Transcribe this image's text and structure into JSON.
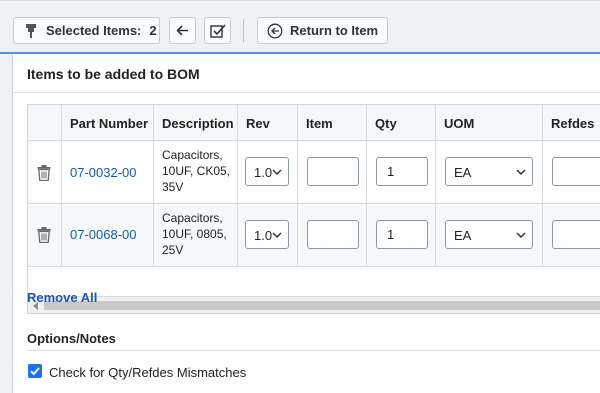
{
  "toolbar": {
    "selected_label": "Selected Items:",
    "selected_count": "2",
    "return_label": "Return to Item"
  },
  "panel": {
    "title": "Items to be added to BOM"
  },
  "table": {
    "columns": [
      "Part Number",
      "Description",
      "Rev",
      "Item",
      "Qty",
      "UOM",
      "Refdes"
    ],
    "rows": [
      {
        "part_number": "07-0032-00",
        "description": [
          "Capacitors,",
          "10UF, CK05,",
          "35V"
        ],
        "rev": "1.0",
        "item": "",
        "qty": "1",
        "uom": "EA",
        "refdes": ""
      },
      {
        "part_number": "07-0068-00",
        "description": [
          "Capacitors,",
          "10UF, 0805,",
          "25V"
        ],
        "rev": "1.0",
        "item": "",
        "qty": "1",
        "uom": "EA",
        "refdes": ""
      }
    ]
  },
  "remove_all_label": "Remove All",
  "options": {
    "title": "Options/Notes",
    "check_label": "Check for Qty/Refdes Mismatches",
    "check_checked": true
  },
  "colors": {
    "link": "#1b5aa8",
    "accent": "#5b8fd6",
    "checkbox": "#1a73e8"
  },
  "icons": [
    "pin-icon",
    "back-arrow-icon",
    "checklist-icon",
    "circle-arrow-left-icon",
    "trash-icon",
    "chevron-down-icon",
    "check-icon"
  ]
}
